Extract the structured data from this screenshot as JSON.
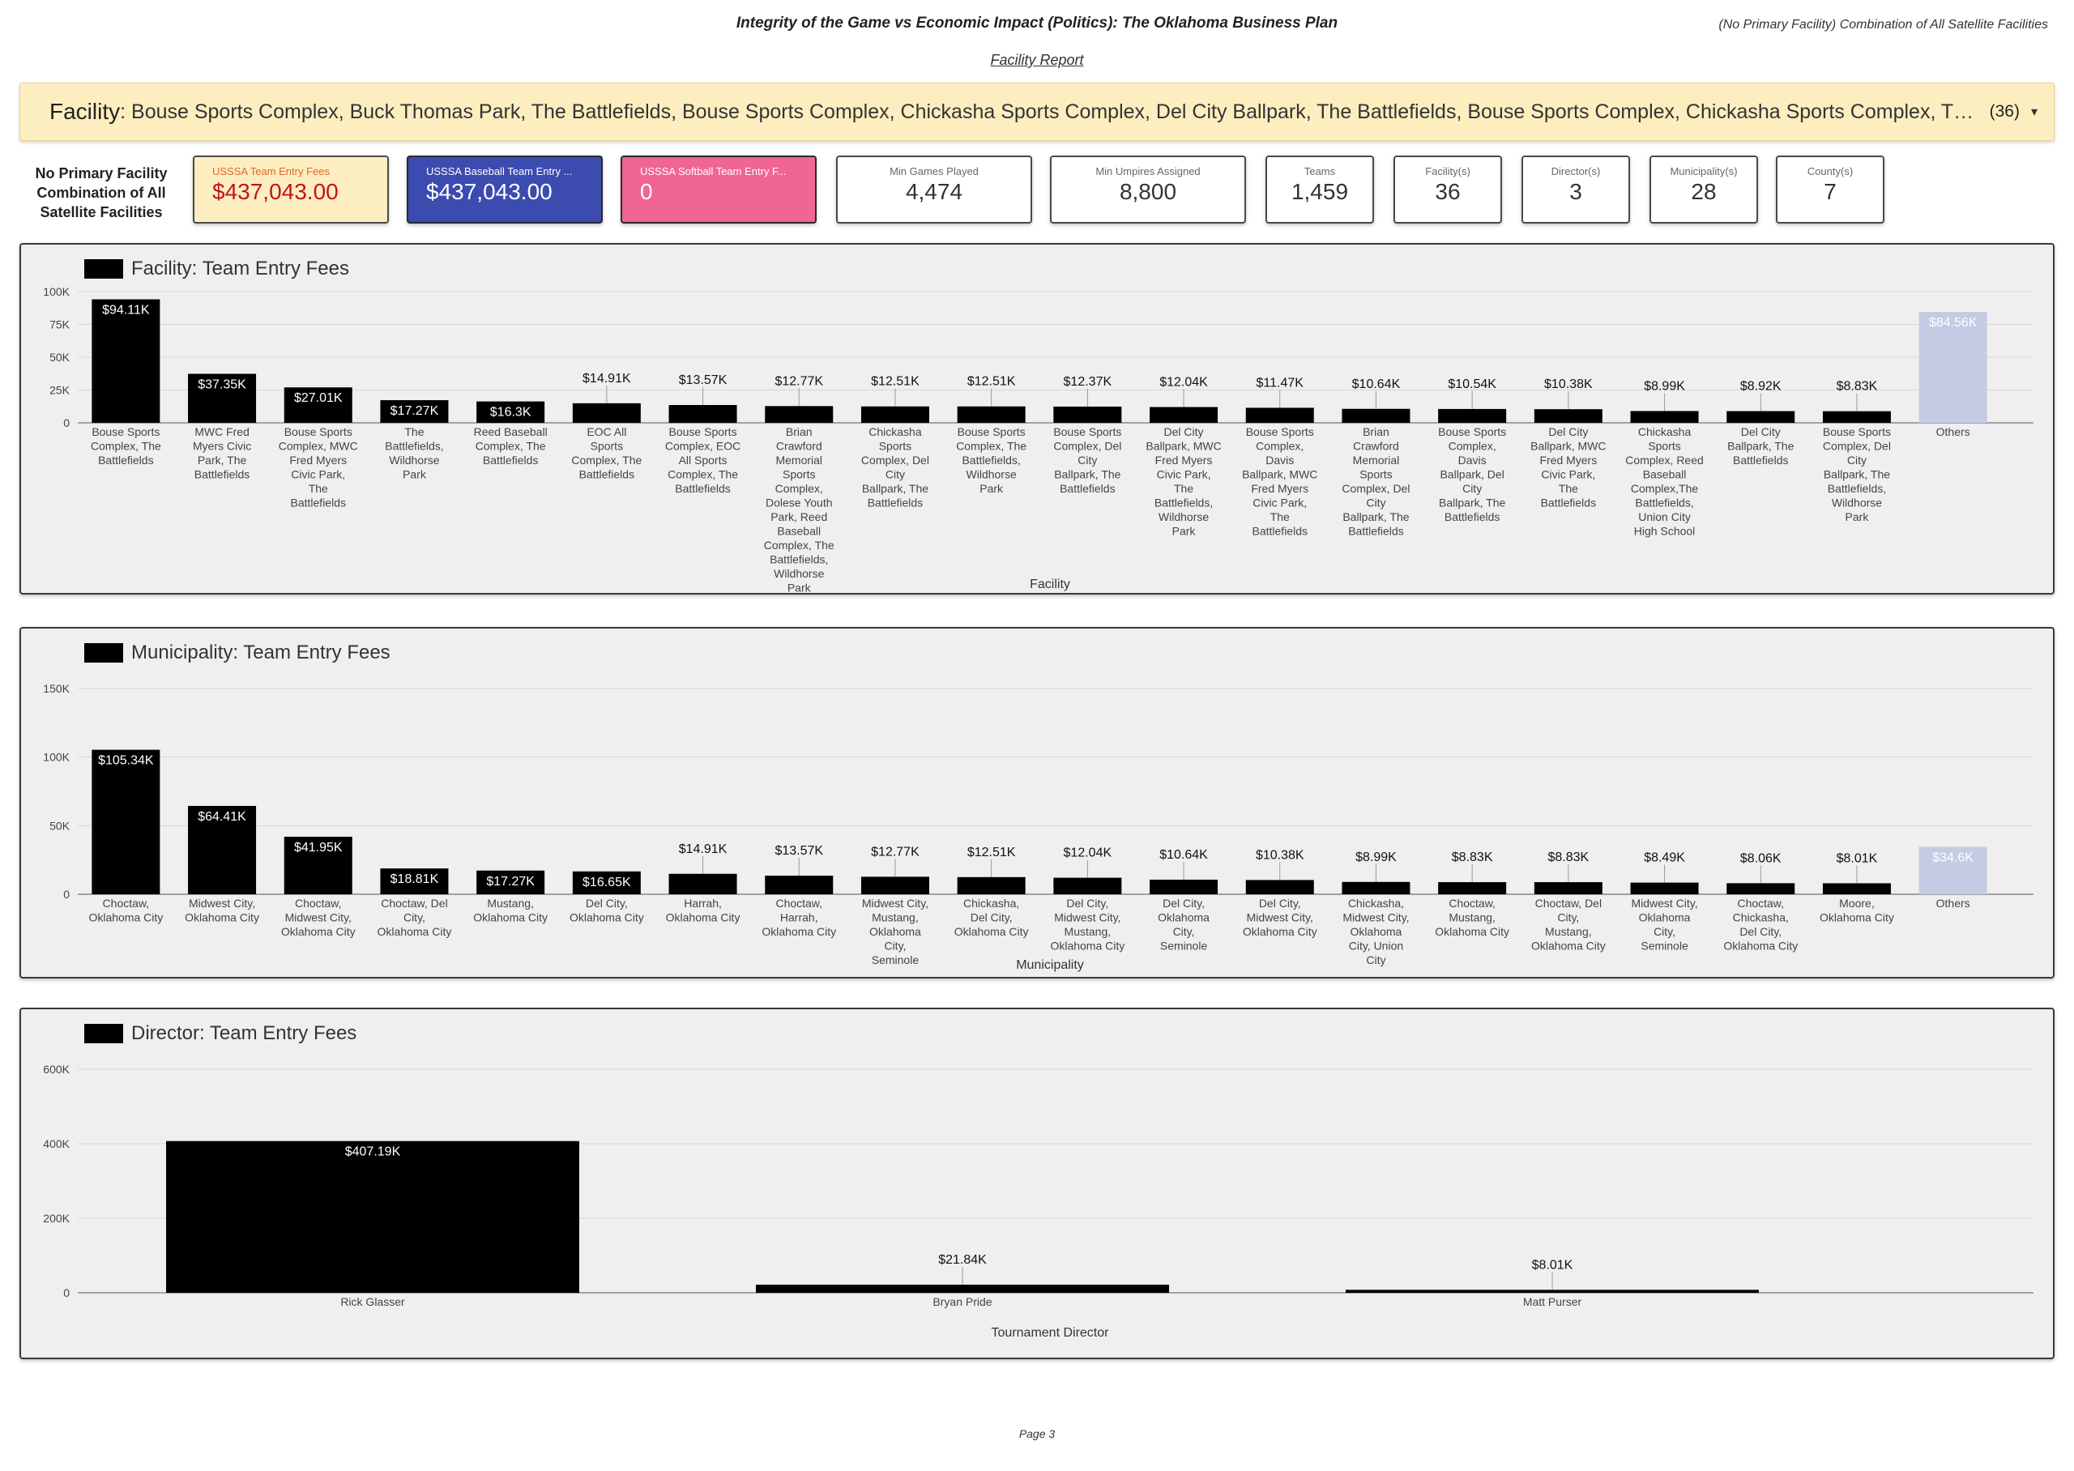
{
  "header": {
    "title": "Integrity of the Game vs Economic Impact (Politics): The Oklahoma Business Plan",
    "subtitle": "Facility Report",
    "right_text": "(No Primary Facility) Combination of All Satellite Facilities"
  },
  "filter": {
    "label": "Facility",
    "value": ": Bouse Sports Complex, Buck Thomas Park, The Battlefields, Bouse Sports Complex, Chickasha Sports Complex, Del City Ballpark, The Battlefields, Bouse Sports Complex, Chickasha Sports Complex, The Battlefields, Bouse Sports Complex, Del City Ballpark",
    "count": "(36)",
    "caret": "▾"
  },
  "side_label": "No Primary Facility Combination of All Satellite Facilities",
  "kpis": [
    {
      "label": "USSSA Team Entry Fees",
      "value": "$437,043.00",
      "bg": "#fdeebf",
      "label_color": "#e0662e",
      "value_color": "#c0141a",
      "border": "#4a4a4a"
    },
    {
      "label": "USSSA Baseball Team Entry ...",
      "value": "$437,043.00",
      "bg": "#3c4bb0",
      "label_color": "#ffffff",
      "value_color": "#ffffff",
      "border": "#2a2a2a"
    },
    {
      "label": "USSSA Softball Team Entry F...",
      "value": "0",
      "bg": "#f06594",
      "label_color": "#ffffff",
      "value_color": "#ffffff",
      "border": "#2a2a2a"
    },
    {
      "label": "Min Games Played",
      "value": "4,474"
    },
    {
      "label": "Min Umpires Assigned",
      "value": "8,800"
    },
    {
      "label": "Teams",
      "value": "1,459"
    },
    {
      "label": "Facility(s)",
      "value": "36"
    },
    {
      "label": "Director(s)",
      "value": "3"
    },
    {
      "label": "Municipality(s)",
      "value": "28"
    },
    {
      "label": "County(s)",
      "value": "7"
    }
  ],
  "colors": {
    "bar": "#000000",
    "others": "#c5cbe3",
    "grid": "#d6d6d6",
    "axis": "#888888"
  },
  "chart_data": [
    {
      "type": "bar",
      "title": "Facility: Team Entry Fees",
      "xlabel": "Facility",
      "ylim": [
        0,
        100000
      ],
      "yticks": [
        "0",
        "25K",
        "50K",
        "75K",
        "100K"
      ],
      "ytick_values": [
        0,
        25000,
        50000,
        75000,
        100000
      ],
      "categories": [
        "Bouse Sports Complex, The Battlefields",
        "MWC Fred Myers Civic Park, The Battlefields",
        "Bouse Sports Complex, MWC Fred Myers Civic Park, The Battlefields",
        "The Battlefields, Wildhorse Park",
        "Reed Baseball Complex, The Battlefields",
        "EOC All Sports Complex, The Battlefields",
        "Bouse Sports Complex, EOC All Sports Complex, The Battlefields",
        "Brian Crawford Memorial Sports Complex, Dolese Youth Park, Reed Baseball Complex, The Battlefields, Wildhorse Park",
        "Chickasha Sports Complex, Del City Ballpark, The Battlefields",
        "Bouse Sports Complex, The Battlefields, Wildhorse Park",
        "Bouse Sports Complex, Del City Ballpark, The Battlefields",
        "Del City Ballpark, MWC Fred Myers Civic Park, The Battlefields, Wildhorse Park",
        "Bouse Sports Complex, Davis Ballpark, MWC Fred Myers Civic Park, The Battlefields",
        "Brian Crawford Memorial Sports Complex, Del City Ballpark, The Battlefields",
        "Bouse Sports Complex, Davis Ballpark, Del City Ballpark, The Battlefields",
        "Del City Ballpark, MWC Fred Myers Civic Park, The Battlefields",
        "Chickasha Sports Complex, Reed Baseball Complex,The Battlefields, Union City High School",
        "Del City Ballpark, The Battlefields",
        "Bouse Sports Complex, Del City Ballpark, The Battlefields, Wildhorse Park",
        "Others"
      ],
      "values": [
        94110,
        37350,
        27010,
        17270,
        16300,
        14910,
        13570,
        12770,
        12510,
        12510,
        12370,
        12040,
        11470,
        10640,
        10540,
        10380,
        8990,
        8920,
        8830,
        84560
      ],
      "labels": [
        "$94.11K",
        "$37.35K",
        "$27.01K",
        "$17.27K",
        "$16.3K",
        "$14.91K",
        "$13.57K",
        "$12.77K",
        "$12.51K",
        "$12.51K",
        "$12.37K",
        "$12.04K",
        "$11.47K",
        "$10.64K",
        "$10.54K",
        "$10.38K",
        "$8.99K",
        "$8.92K",
        "$8.83K",
        "$84.56K"
      ]
    },
    {
      "type": "bar",
      "title": "Municipality: Team Entry Fees",
      "xlabel": "Municipality",
      "ylim": [
        0,
        150000
      ],
      "yticks": [
        "0",
        "50K",
        "100K",
        "150K"
      ],
      "ytick_values": [
        0,
        50000,
        100000,
        150000
      ],
      "categories": [
        "Choctaw, Oklahoma City",
        "Midwest City, Oklahoma City",
        "Choctaw, Midwest City, Oklahoma City",
        "Choctaw, Del City, Oklahoma City",
        "Mustang, Oklahoma City",
        "Del City, Oklahoma City",
        "Harrah, Oklahoma City",
        "Choctaw, Harrah, Oklahoma City",
        "Midwest City, Mustang, Oklahoma City, Seminole",
        "Chickasha, Del City, Oklahoma City",
        "Del City, Midwest City, Mustang, Oklahoma City",
        "Del City, Oklahoma City, Seminole",
        "Del City, Midwest City, Oklahoma City",
        "Chickasha, Midwest City, Oklahoma City, Union City",
        "Choctaw, Mustang, Oklahoma City",
        "Choctaw, Del City, Mustang, Oklahoma City",
        "Midwest City, Oklahoma City, Seminole",
        "Choctaw, Chickasha, Del City, Oklahoma City",
        "Moore, Oklahoma City",
        "Others"
      ],
      "values": [
        105340,
        64410,
        41950,
        18810,
        17270,
        16650,
        14910,
        13570,
        12770,
        12510,
        12040,
        10640,
        10380,
        8990,
        8830,
        8830,
        8490,
        8060,
        8010,
        34600
      ],
      "labels": [
        "$105.34K",
        "$64.41K",
        "$41.95K",
        "$18.81K",
        "$17.27K",
        "$16.65K",
        "$14.91K",
        "$13.57K",
        "$12.77K",
        "$12.51K",
        "$12.04K",
        "$10.64K",
        "$10.38K",
        "$8.99K",
        "$8.83K",
        "$8.83K",
        "$8.49K",
        "$8.06K",
        "$8.01K",
        "$34.6K"
      ]
    },
    {
      "type": "bar",
      "title": "Director: Team Entry Fees",
      "xlabel": "Tournament Director",
      "ylim": [
        0,
        600000
      ],
      "yticks": [
        "0",
        "200K",
        "400K",
        "600K"
      ],
      "ytick_values": [
        0,
        200000,
        400000,
        600000
      ],
      "categories": [
        "Rick Glasser",
        "Bryan Pride",
        "Matt Purser"
      ],
      "values": [
        407190,
        21840,
        8010
      ],
      "labels": [
        "$407.19K",
        "$21.84K",
        "$8.01K"
      ]
    }
  ],
  "footer": {
    "page": "Page 3"
  }
}
